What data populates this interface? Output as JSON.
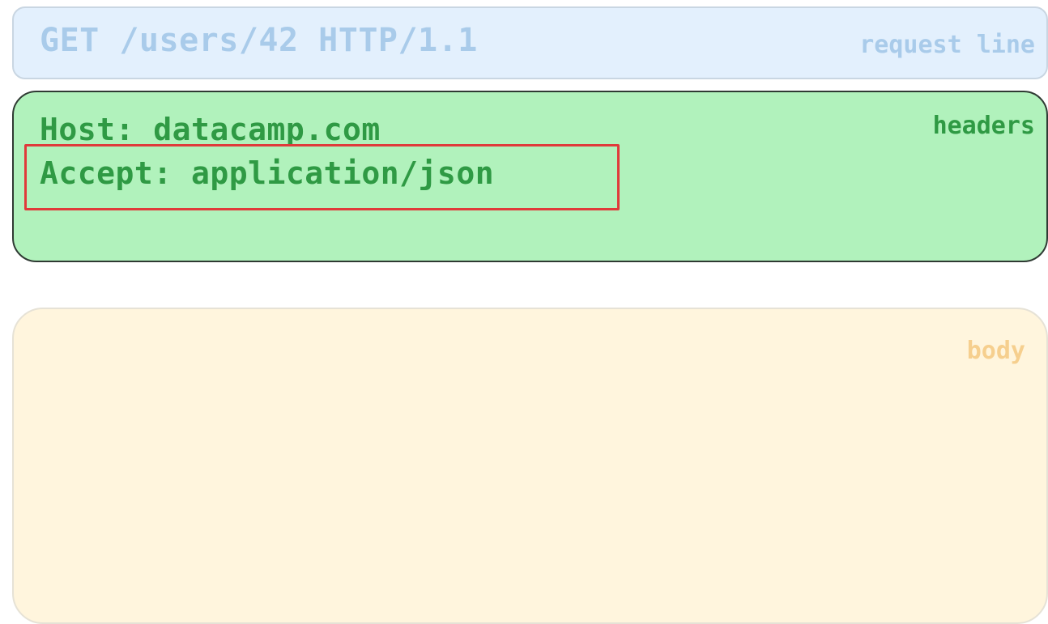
{
  "request_line": {
    "text": "GET /users/42 HTTP/1.1",
    "label": "request line",
    "color": "#a9cbea",
    "background": "#e3f0fd"
  },
  "headers": {
    "lines": [
      "Host: datacamp.com",
      "Accept: application/json"
    ],
    "label": "headers",
    "color": "#2f9a44",
    "background": "#b1f2bc"
  },
  "body": {
    "label": "body",
    "color": "#f6cf8e",
    "background": "#fff5dd"
  },
  "highlight": {
    "target": "Accept: application/json",
    "color": "#e03a3a"
  }
}
